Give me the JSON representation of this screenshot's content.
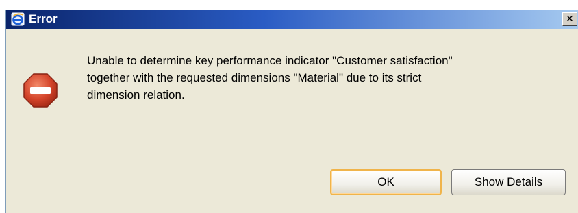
{
  "window": {
    "title": "Error",
    "close_glyph": "✕",
    "app_icon": "ie-icon"
  },
  "dialog": {
    "icon": "error-stop-icon",
    "message_lines": [
      "Unable to determine key performance indicator \"Customer satisfaction\"",
      "together with the requested dimensions \"Material\" due to its strict",
      "dimension relation."
    ]
  },
  "buttons": {
    "ok_label": "OK",
    "details_label": "Show Details"
  },
  "colors": {
    "titlebar_start": "#0a246a",
    "titlebar_end": "#a6caf0",
    "dialog_bg": "#ece9d8",
    "error_red": "#d4442a",
    "default_button_border": "#f0b44a"
  }
}
